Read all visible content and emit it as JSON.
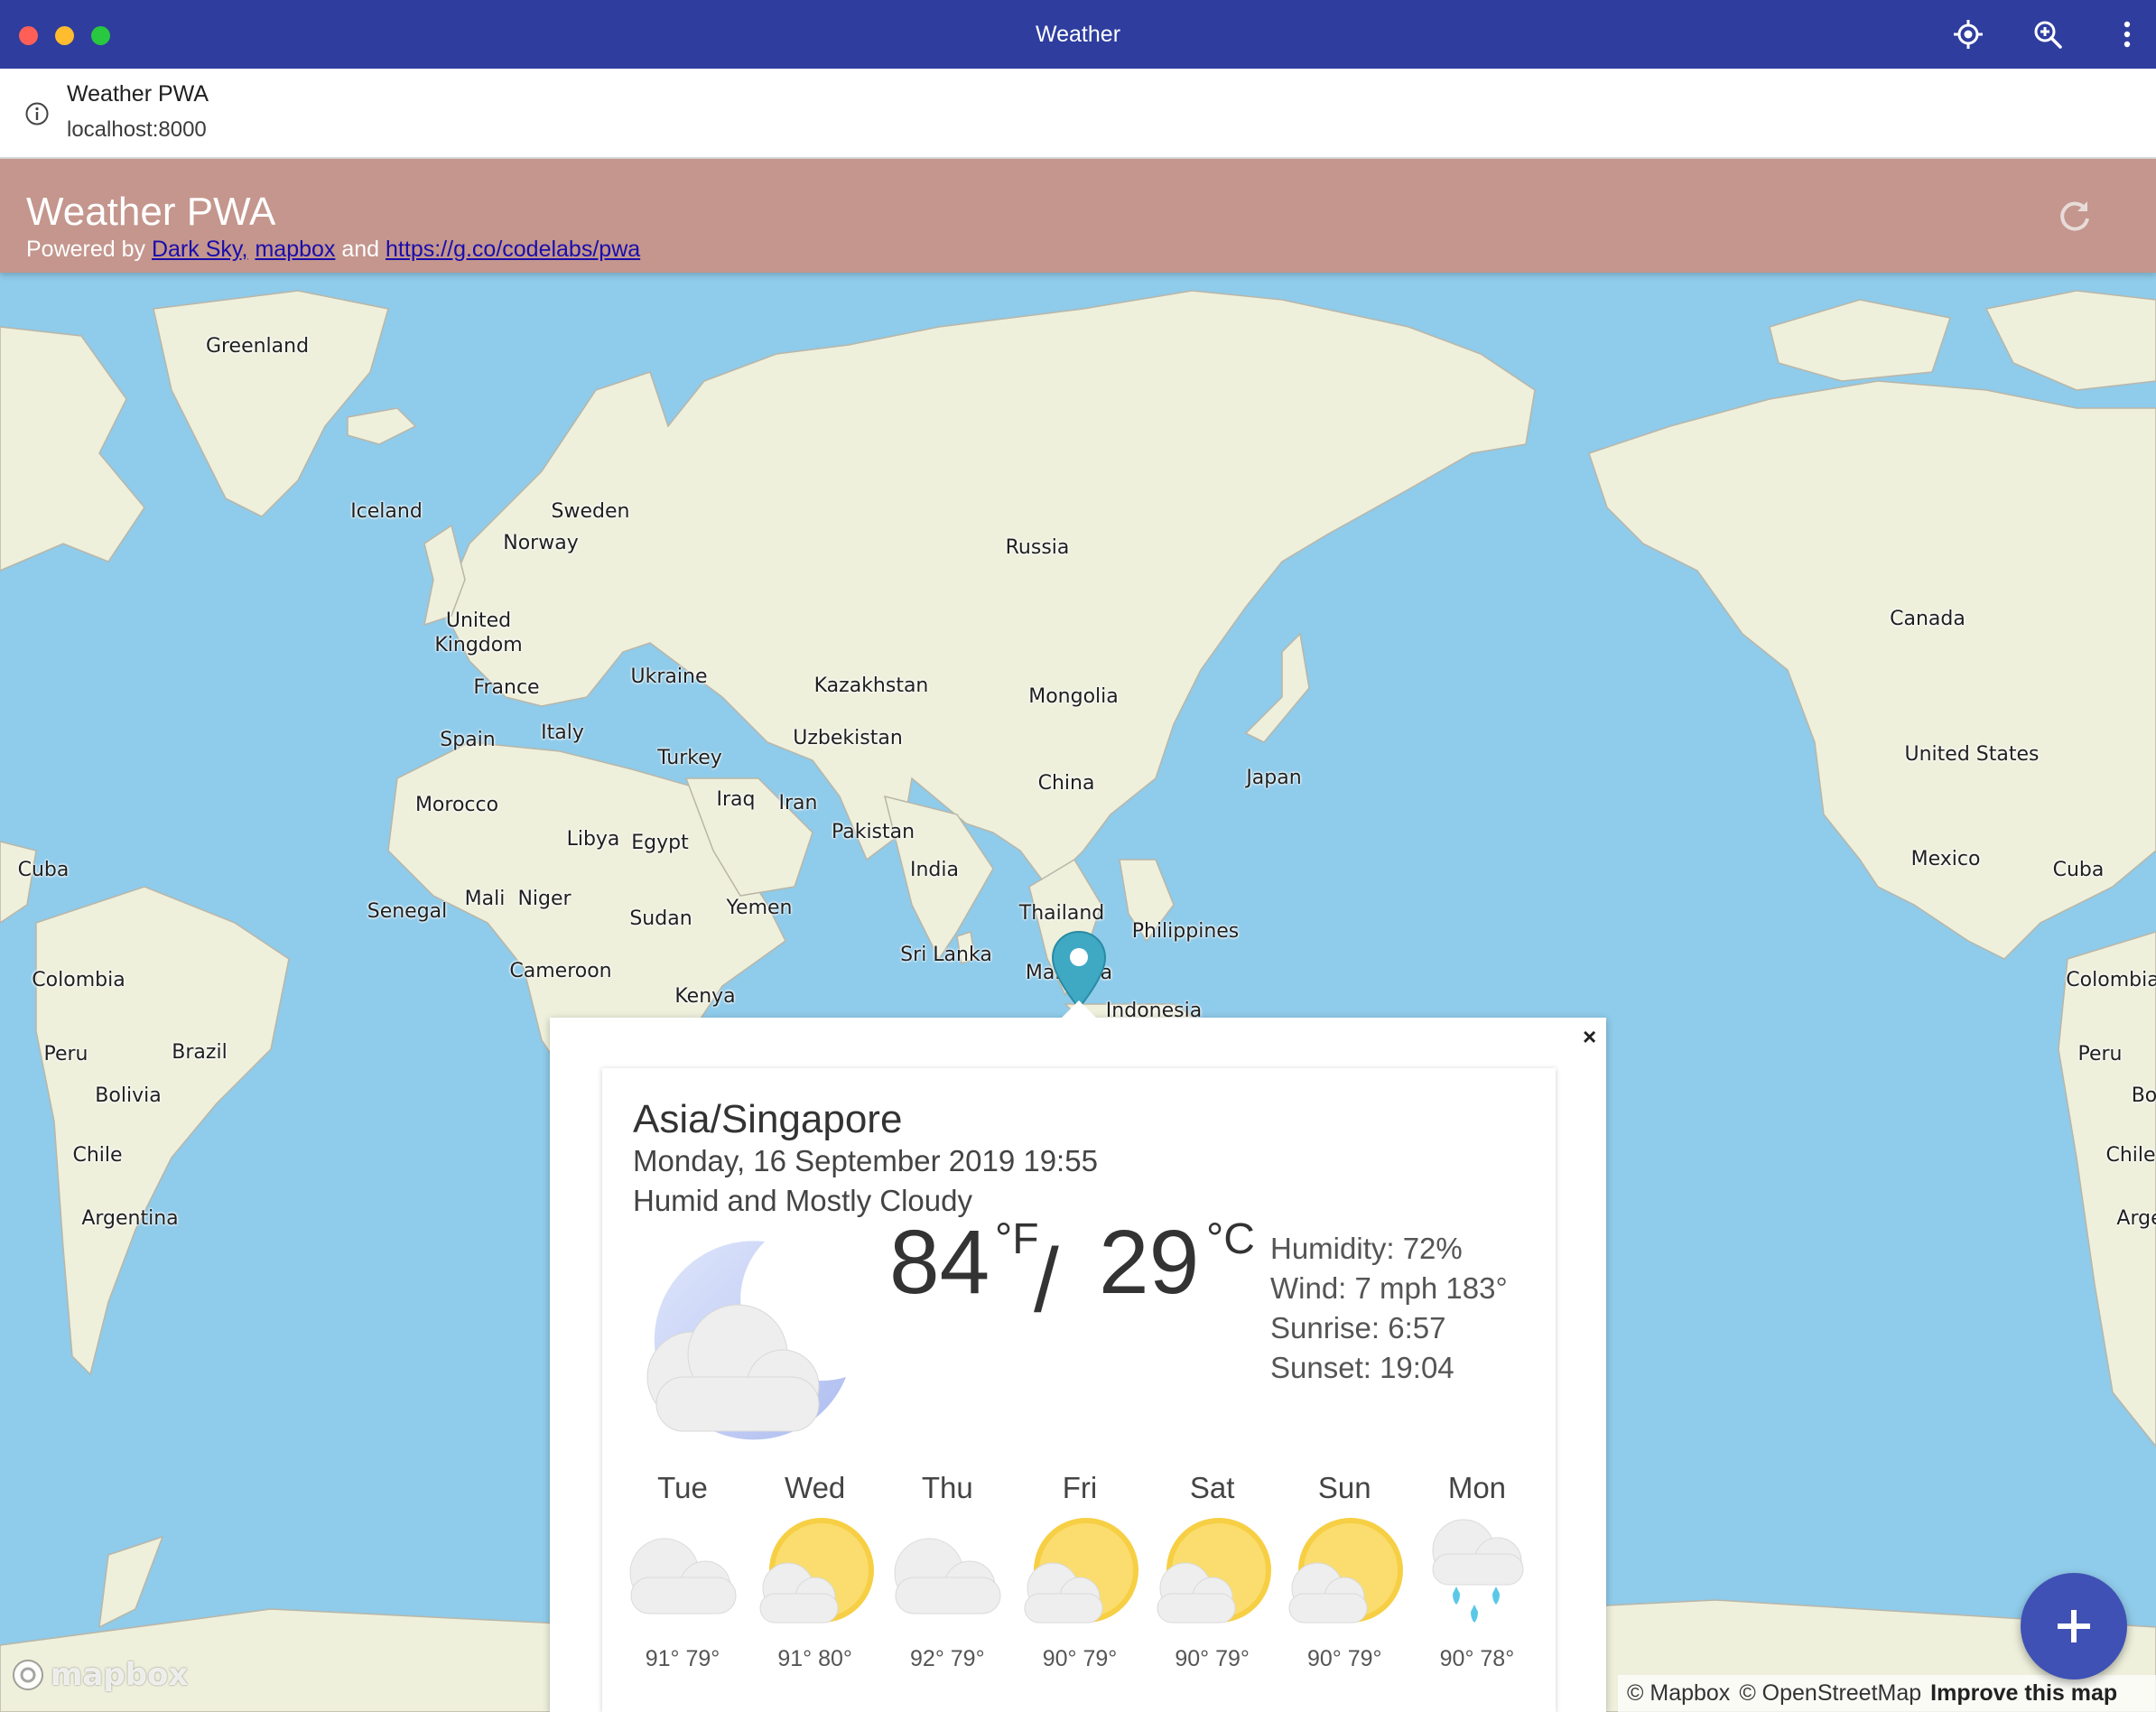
{
  "window": {
    "title": "Weather",
    "icons": [
      "location-icon",
      "zoom-icon",
      "more-icon"
    ]
  },
  "site": {
    "name": "Weather PWA",
    "url": "localhost:8000"
  },
  "header": {
    "title": "Weather PWA",
    "powered_prefix": "Powered by ",
    "link_darksky": "Dark Sky,",
    "link_mapbox": "mapbox",
    "and_text": " and ",
    "link_codelab": "https://g.co/codelabs/pwa",
    "color": "#c4968d"
  },
  "map": {
    "labels": {
      "greenland": "Greenland",
      "iceland": "Iceland",
      "sweden": "Sweden",
      "norway": "Norway",
      "uk": "United\nKingdom",
      "france": "France",
      "spain": "Spain",
      "italy": "Italy",
      "ukraine": "Ukraine",
      "russia": "Russia",
      "kazakhstan": "Kazakhstan",
      "mongolia": "Mongolia",
      "uzbekistan": "Uzbekistan",
      "turkey": "Turkey",
      "iraq": "Iraq",
      "iran": "Iran",
      "china": "China",
      "japan": "Japan",
      "pakistan": "Pakistan",
      "india": "India",
      "morocco": "Morocco",
      "libya": "Libya",
      "egypt": "Egypt",
      "yemen": "Yemen",
      "mali": "Mali",
      "niger": "Niger",
      "senegal": "Senegal",
      "sudan": "Sudan",
      "cameroon": "Cameroon",
      "kenya": "Kenya",
      "thailand": "Thailand",
      "philippines": "Philippines",
      "srilanka": "Sri Lanka",
      "malaysia": "Malaysia",
      "indonesia": "Indonesia",
      "cuba_left": "Cuba",
      "colombia_left": "Colombia",
      "peru_left": "Peru",
      "brazil": "Brazil",
      "bolivia": "Bolivia",
      "chile_left": "Chile",
      "argentina": "Argentina",
      "canada": "Canada",
      "usa": "United States",
      "mexico": "Mexico",
      "cuba_right": "Cuba",
      "colombia_right": "Colombia",
      "peru_right": "Peru",
      "bo_right": "Bo",
      "chile_right": "Chile",
      "arg_right": "Arge"
    },
    "logo": "mapbox",
    "attribution": {
      "mapbox": "© Mapbox",
      "osm": "© OpenStreetMap",
      "improve": "Improve this map"
    },
    "water_color": "#8fcbea",
    "land_color": "#eef0dc"
  },
  "popup": {
    "close": "×",
    "city": "Asia/Singapore",
    "date": "Monday, 16 September 2019 19:55",
    "description": "Humid and Mostly Cloudy",
    "current_icon": "partly-cloudy-night-icon",
    "temp_f": "84",
    "unit_f": "°F",
    "slash": "/",
    "temp_c": "29",
    "unit_c": "°C",
    "details": {
      "humidity": "Humidity: 72%",
      "wind": "Wind: 7 mph 183°",
      "sunrise": "Sunrise: 6:57",
      "sunset": "Sunset: 19:04"
    },
    "forecast": [
      {
        "day": "Tue",
        "icon": "cloudy-icon",
        "temps": "91° 79°"
      },
      {
        "day": "Wed",
        "icon": "partly-cloudy-day-icon",
        "temps": "91° 80°"
      },
      {
        "day": "Thu",
        "icon": "cloudy-icon",
        "temps": "92° 79°"
      },
      {
        "day": "Fri",
        "icon": "partly-cloudy-day-icon",
        "temps": "90° 79°"
      },
      {
        "day": "Sat",
        "icon": "partly-cloudy-day-icon",
        "temps": "90° 79°"
      },
      {
        "day": "Sun",
        "icon": "partly-cloudy-day-icon",
        "temps": "90° 79°"
      },
      {
        "day": "Mon",
        "icon": "rain-icon",
        "temps": "90° 78°"
      }
    ]
  },
  "fab": {
    "icon": "add-icon",
    "color": "#3f51b5"
  }
}
